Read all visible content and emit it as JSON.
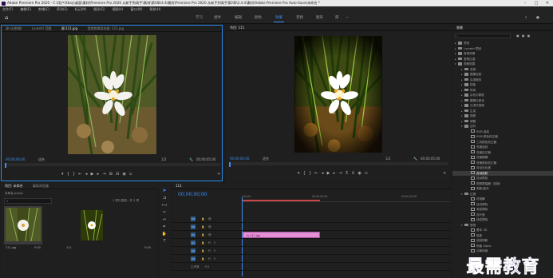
{
  "window": {
    "title": "Adobe Premiere Pro 2020 - C:\\用户\\Xbxy\\桌面\\素材\\Premiere Pro 2020 从新手到高手\\素材\\第4章\\4.4\\最终\\Premiere Pro 2020 从新手到高手第2章\\2.4.4\\素材\\Adobe Premiere Pro Auto-Save\\未命名 *",
    "min": "–",
    "max": "□",
    "close": "✕"
  },
  "menu": [
    "文件(F)",
    "编辑(E)",
    "剪辑(C)",
    "序列(S)",
    "标记(M)",
    "图形(G)",
    "视图(V)",
    "窗口(W)",
    "帮助(H)"
  ],
  "workspaces": [
    "学习",
    "组件",
    "编辑",
    "颜色",
    "效果",
    "音频",
    "图形",
    "库"
  ],
  "active_workspace": "效果",
  "source_panel": {
    "tabs": [
      "源:(无剪辑)",
      "Lumetri 范围",
      "源:111.jpg",
      "音频剪辑混合器: 111.jpg"
    ],
    "active_tab": "源:111.jpg",
    "timecode": "00;00;00;00",
    "fit": "适合",
    "ratio": "1/2",
    "end_timecode": "00;00;05;00"
  },
  "program_panel": {
    "tab": "节目: 111",
    "timecode": "00;00;00;00",
    "fit": "适合",
    "ratio": "1/2",
    "end_timecode": "00;00;05;00"
  },
  "project_panel": {
    "tabs": [
      "项目: 未命名",
      "媒体浏览器"
    ],
    "project_file": "未命名.prproj",
    "status": "1 项已选择，共 2 项",
    "items": [
      {
        "name": "111.jpg",
        "duration": "5:00"
      },
      {
        "name": "111",
        "duration": "5:00"
      }
    ]
  },
  "timeline": {
    "tab": "111",
    "timecode": "00;00;00;00",
    "ruler": [
      "00;00",
      "00;00;05;00",
      "00;00;10;00"
    ],
    "video_tracks": [
      "V3",
      "V2",
      "V1"
    ],
    "audio_tracks": [
      "A1",
      "A2",
      "A3"
    ],
    "master": "主声道",
    "master_value": "0.0",
    "clip": "111.jpg"
  },
  "effects_panel": {
    "title": "效果",
    "items": [
      {
        "label": "预设",
        "level": 0,
        "kind": "folder"
      },
      {
        "label": "Lumetri 预设",
        "level": 0,
        "kind": "folder"
      },
      {
        "label": "音频效果",
        "level": 0,
        "kind": "folder"
      },
      {
        "label": "音频过渡",
        "level": 0,
        "kind": "folder"
      },
      {
        "label": "视频效果",
        "level": 0,
        "kind": "folder",
        "open": true
      },
      {
        "label": "变换",
        "level": 1,
        "kind": "folder"
      },
      {
        "label": "图像控制",
        "level": 1,
        "kind": "folder"
      },
      {
        "label": "实用程序",
        "level": 1,
        "kind": "folder"
      },
      {
        "label": "扭曲",
        "level": 1,
        "kind": "folder"
      },
      {
        "label": "时间",
        "level": 1,
        "kind": "folder"
      },
      {
        "label": "杂色与颗粒",
        "level": 1,
        "kind": "folder"
      },
      {
        "label": "模糊与锐化",
        "level": 1,
        "kind": "folder"
      },
      {
        "label": "沉浸式视频",
        "level": 1,
        "kind": "folder"
      },
      {
        "label": "生成",
        "level": 1,
        "kind": "folder"
      },
      {
        "label": "视频",
        "level": 1,
        "kind": "folder"
      },
      {
        "label": "调整",
        "level": 1,
        "kind": "folder"
      },
      {
        "label": "过时",
        "level": 1,
        "kind": "folder",
        "open": true
      },
      {
        "label": "RGB 曲线",
        "level": 2,
        "kind": "fx"
      },
      {
        "label": "RGB 颜色校正器",
        "level": 2,
        "kind": "fx"
      },
      {
        "label": "三向颜色校正器",
        "level": 2,
        "kind": "fx"
      },
      {
        "label": "亮度曲线",
        "level": 2,
        "kind": "fx"
      },
      {
        "label": "亮度校正器",
        "level": 2,
        "kind": "fx"
      },
      {
        "label": "快速模糊",
        "level": 2,
        "kind": "fx"
      },
      {
        "label": "快速颜色校正器",
        "level": 2,
        "kind": "fx"
      },
      {
        "label": "自动对比度",
        "level": 2,
        "kind": "fx"
      },
      {
        "label": "自动色阶",
        "level": 2,
        "kind": "fx",
        "selected": true
      },
      {
        "label": "自动颜色",
        "level": 2,
        "kind": "fx"
      },
      {
        "label": "视频限幅器（旧版）",
        "level": 2,
        "kind": "fx"
      },
      {
        "label": "阴影/高光",
        "level": 2,
        "kind": "fx"
      },
      {
        "label": "过渡",
        "level": 1,
        "kind": "folder",
        "open": true
      },
      {
        "label": "块溶解",
        "level": 2,
        "kind": "fx"
      },
      {
        "label": "径向擦除",
        "level": 2,
        "kind": "fx"
      },
      {
        "label": "渐变擦除",
        "level": 2,
        "kind": "fx"
      },
      {
        "label": "百叶窗",
        "level": 2,
        "kind": "fx"
      },
      {
        "label": "线性擦除",
        "level": 2,
        "kind": "fx"
      },
      {
        "label": "透视",
        "level": 1,
        "kind": "folder",
        "open": true
      },
      {
        "label": "基本 3D",
        "level": 2,
        "kind": "fx"
      },
      {
        "label": "投影",
        "level": 2,
        "kind": "fx"
      },
      {
        "label": "放射阴影",
        "level": 2,
        "kind": "fx"
      },
      {
        "label": "斜面 Alpha",
        "level": 2,
        "kind": "fx"
      },
      {
        "label": "边缘斜面",
        "level": 2,
        "kind": "fx"
      }
    ]
  },
  "watermark": "最需教育",
  "colors": {
    "accent": "#2d8ceb",
    "clip": "#e58fd6",
    "watermark": "#2b35c8"
  }
}
